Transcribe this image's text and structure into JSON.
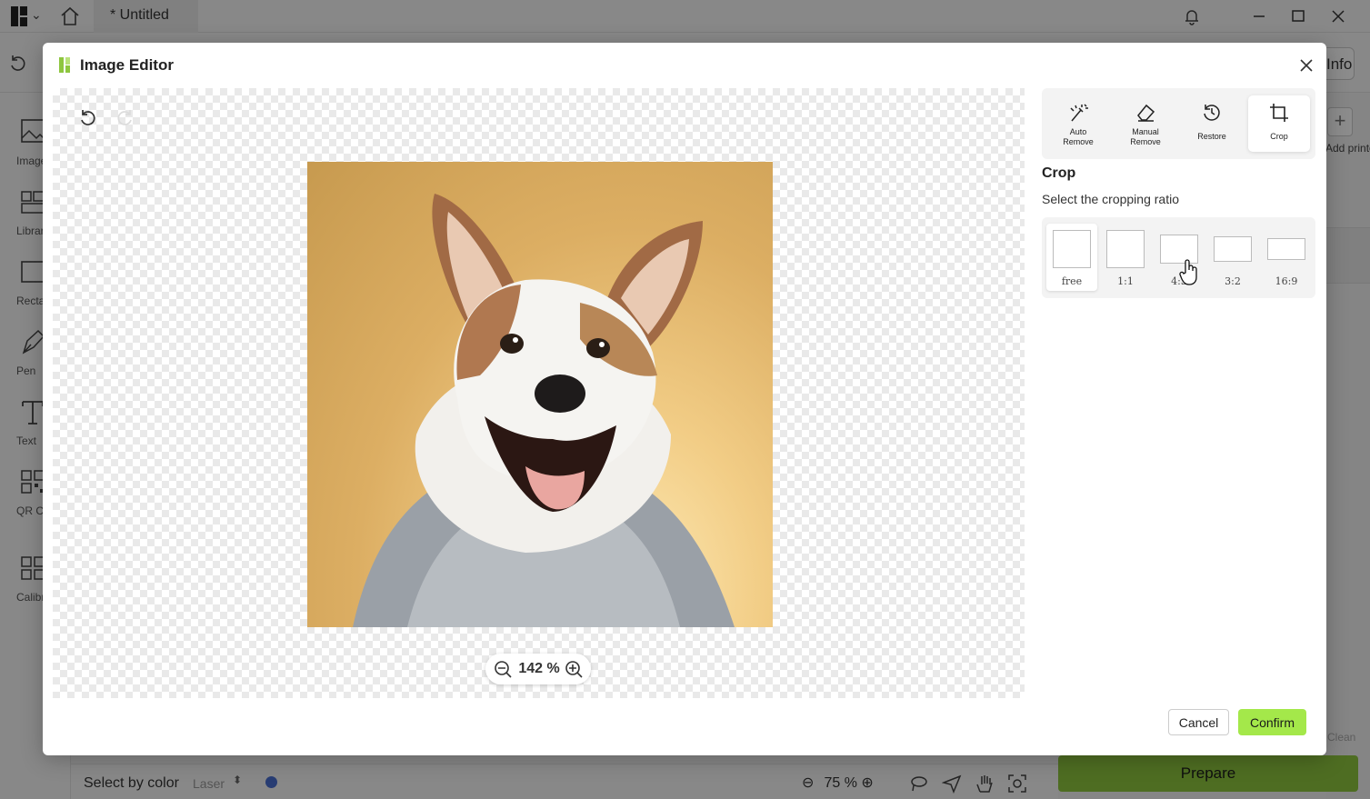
{
  "app": {
    "tab_title": "* Untitled",
    "info_label": "Info",
    "window_controls": [
      "minimize-icon",
      "maximize-icon",
      "close-icon"
    ],
    "left_rail": [
      {
        "label": "Image",
        "icon": "image-icon"
      },
      {
        "label": "Library",
        "icon": "library-icon"
      },
      {
        "label": "Rectangle",
        "icon": "rectangle-icon"
      },
      {
        "label": "Pen",
        "icon": "pen-icon"
      },
      {
        "label": "Text",
        "icon": "text-icon"
      },
      {
        "label": "QR Code",
        "icon": "qr-code-icon"
      },
      {
        "label": "Calibration",
        "icon": "calibration-icon"
      }
    ],
    "add_printer_label": "Add printer",
    "clean_label": "Clean",
    "bottom": {
      "select_by_color": "Select by color",
      "mode": "Laser",
      "color": "#4a6fd1",
      "zoom": "75 %"
    },
    "prepare_label": "Prepare"
  },
  "modal": {
    "title": "Image Editor",
    "tools": [
      {
        "label": "Auto\nRemove",
        "icon": "auto-remove-icon",
        "active": false
      },
      {
        "label": "Manual\nRemove",
        "icon": "eraser-icon",
        "active": false
      },
      {
        "label": "Restore",
        "icon": "restore-icon",
        "active": false
      },
      {
        "label": "Crop",
        "icon": "crop-icon",
        "active": true
      }
    ],
    "crop": {
      "heading": "Crop",
      "description": "Select the cropping ratio",
      "ratios": [
        {
          "label": "free",
          "active": true
        },
        {
          "label": "1:1",
          "active": false
        },
        {
          "label": "4:3",
          "active": false
        },
        {
          "label": "3:2",
          "active": false
        },
        {
          "label": "16:9",
          "active": false
        }
      ]
    },
    "zoom_value": "142 %",
    "cancel_label": "Cancel",
    "confirm_label": "Confirm"
  },
  "colors": {
    "accent": "#a4e84a",
    "prepare": "#8ec63f"
  }
}
